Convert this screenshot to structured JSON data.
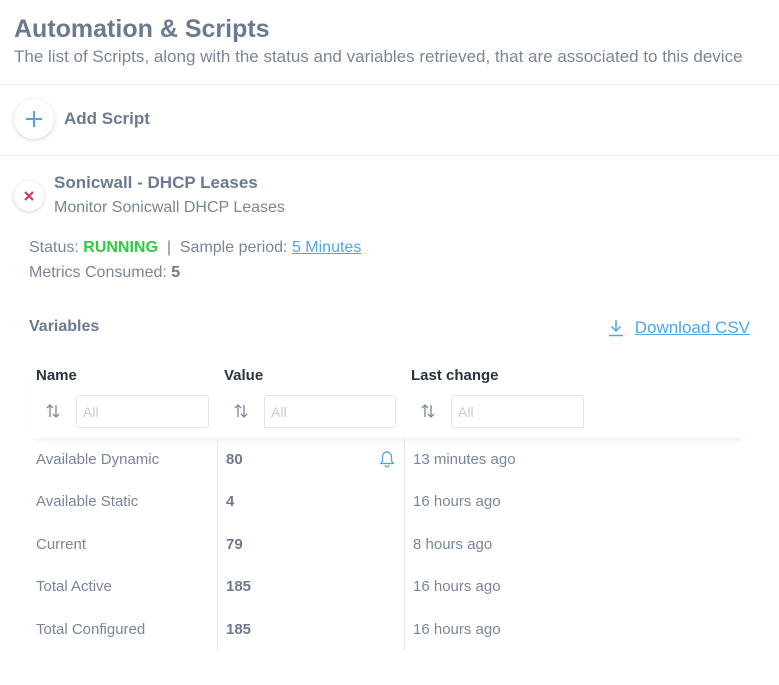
{
  "header": {
    "title": "Automation & Scripts",
    "subtitle": "The list of Scripts, along with the status and variables retrieved, that are associated to this device"
  },
  "add_script": {
    "label": "Add Script",
    "icon": "plus-icon"
  },
  "script": {
    "name": "Sonicwall - DHCP Leases",
    "description": "Monitor Sonicwall DHCP Leases",
    "remove_icon": "close-icon",
    "status_label": "Status:",
    "status_value": "RUNNING",
    "separator": "|",
    "sample_label": "Sample period:",
    "sample_value": "5 Minutes",
    "metrics_label": "Metrics Consumed:",
    "metrics_value": "5"
  },
  "variables": {
    "title": "Variables",
    "download_label": "Download CSV",
    "columns": [
      {
        "label": "Name",
        "placeholder": "All"
      },
      {
        "label": "Value",
        "placeholder": "All"
      },
      {
        "label": "Last change",
        "placeholder": "All"
      }
    ],
    "rows": [
      {
        "name": "Available Dynamic",
        "value": "80",
        "last_change": "13 minutes ago"
      },
      {
        "name": "Available Static",
        "value": "4",
        "last_change": "16 hours ago"
      },
      {
        "name": "Current",
        "value": "79",
        "last_change": "8 hours ago"
      },
      {
        "name": "Total Active",
        "value": "185",
        "last_change": "16 hours ago"
      },
      {
        "name": "Total Configured",
        "value": "185",
        "last_change": "16 hours ago"
      }
    ]
  },
  "colors": {
    "running": "#2ecc40",
    "link": "#4da6e8",
    "remove": "#d6336c",
    "text": "#6b7a90"
  }
}
